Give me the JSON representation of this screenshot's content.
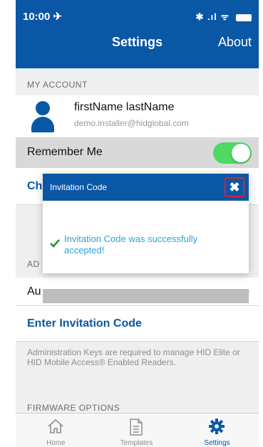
{
  "status": {
    "time": "10:00 ✈",
    "right": "✱ .ıl ᯤ"
  },
  "nav": {
    "title": "Settings",
    "about": "About"
  },
  "account": {
    "header": "MY ACCOUNT",
    "name": "firstName lastName",
    "email": "demo.installer@hidglobal.com"
  },
  "remember": {
    "label": "Remember Me",
    "on": true
  },
  "change": {
    "label": "Ch"
  },
  "admin": {
    "header": "AD",
    "row_label": "Au",
    "enter_label": "Enter Invitation Code",
    "description": "Administration Keys are required to manage HID Elite or HID Mobile Access® Enabled Readers."
  },
  "firmware": {
    "header": "FIRMWARE OPTIONS"
  },
  "tabs": [
    {
      "label": "Home",
      "icon": "home-icon"
    },
    {
      "label": "Templates",
      "icon": "document-icon"
    },
    {
      "label": "Settings",
      "icon": "gear-icon"
    }
  ],
  "dialog": {
    "title": "Invitation Code",
    "close": "✖",
    "message": "Invitation Code was successfully accepted!"
  },
  "colors": {
    "brand": "#0a57a6",
    "toggle": "#4cd964",
    "success": "#27a3d8",
    "close_border": "#e0202e"
  }
}
